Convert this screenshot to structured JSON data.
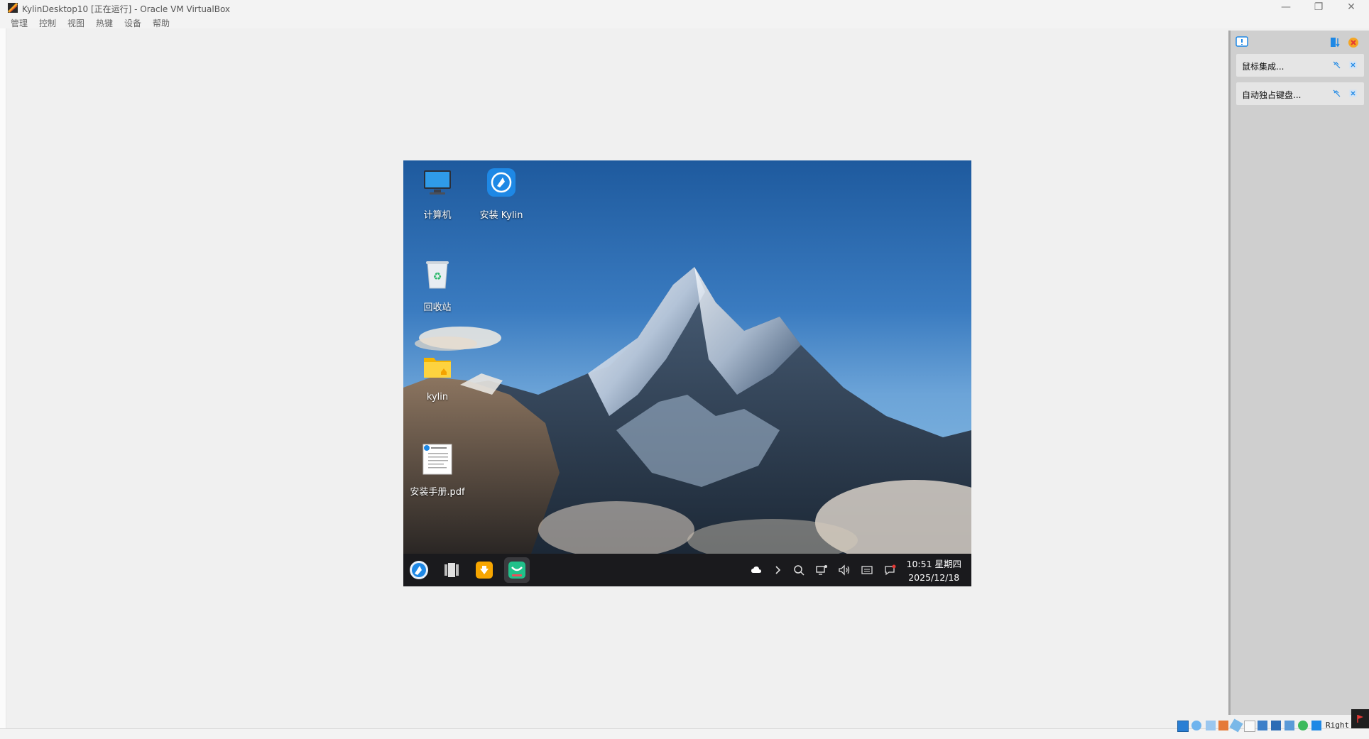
{
  "window": {
    "title": "KylinDesktop10 [正在运行] - Oracle VM VirtualBox",
    "minimize": "—",
    "restore": "❐",
    "close": "✕"
  },
  "menu": [
    "管理",
    "控制",
    "视图",
    "热键",
    "设备",
    "帮助"
  ],
  "desktop": {
    "icons": [
      {
        "label": "计算机"
      },
      {
        "label": "安装 Kylin"
      },
      {
        "label": "回收站"
      },
      {
        "label": "kylin"
      },
      {
        "label": "安装手册.pdf"
      }
    ]
  },
  "taskbar": {
    "time": "10:51 星期四",
    "date": "2025/12/18"
  },
  "notifications": [
    {
      "text": "鼠标集成..."
    },
    {
      "text": "自动独占键盘..."
    }
  ],
  "status": {
    "host_key": "Right"
  },
  "colors": {
    "accent": "#1e88e5",
    "taskbar": "#1a1a1d",
    "panel": "#cfcfcf"
  }
}
